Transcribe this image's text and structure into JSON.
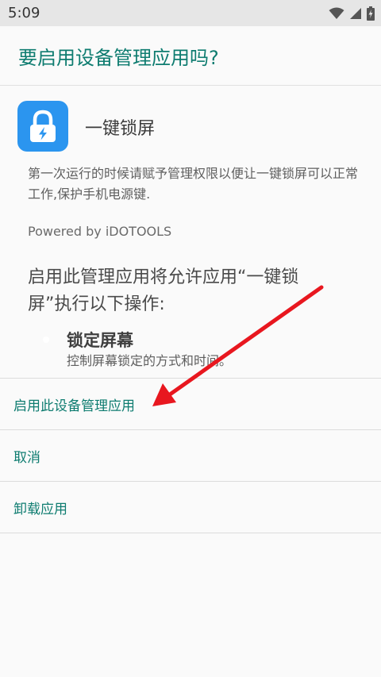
{
  "status_bar": {
    "time": "5:09",
    "icons": [
      "wifi-icon",
      "signal-icon",
      "battery-charging-icon"
    ]
  },
  "header": {
    "title": "要启用设备管理应用吗?"
  },
  "app": {
    "name": "一键锁屏",
    "icon": "lock-icon",
    "brand_color": "#2b95ef",
    "description": "第一次运行的时候请赋予管理权限以便让一键锁屏可以正常工作,保护手机电源键.",
    "powered_by": "Powered by iDOTOOLS"
  },
  "permissions": {
    "intro": "启用此管理应用将允许应用“一键锁屏”执行以下操作:",
    "items": [
      {
        "title": "锁定屏幕",
        "description": "控制屏幕锁定的方式和时间。"
      }
    ]
  },
  "actions": {
    "activate": "启用此设备管理应用",
    "cancel": "取消",
    "uninstall": "卸载应用"
  },
  "colors": {
    "accent": "#0e7c70",
    "annotation_arrow": "#e8171f"
  }
}
